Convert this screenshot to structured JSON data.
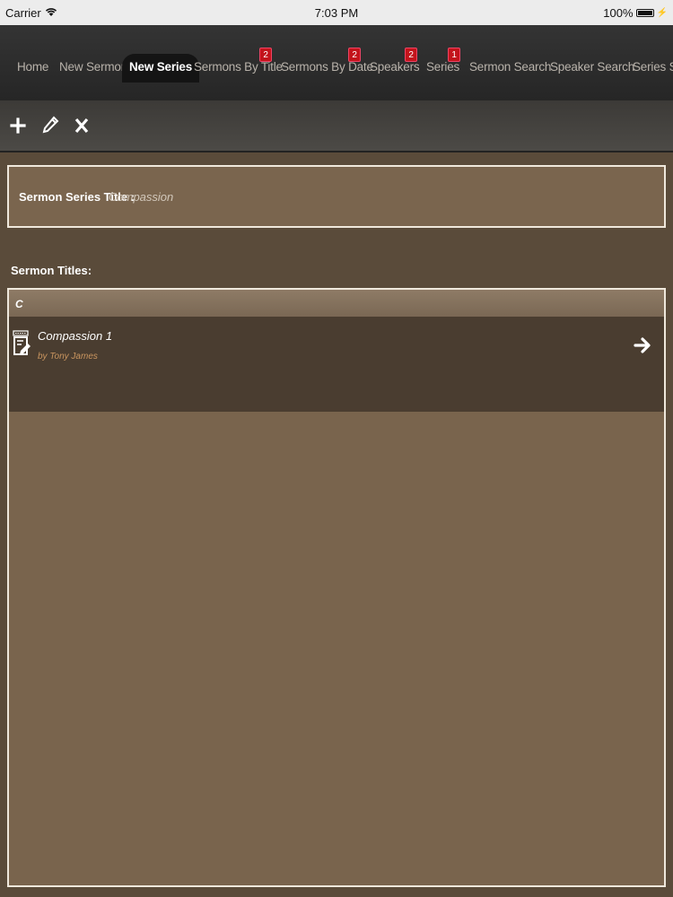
{
  "status_bar": {
    "carrier": "Carrier",
    "time": "7:03 PM",
    "battery": "100%"
  },
  "tabs": [
    {
      "label": "Home",
      "badge": null,
      "active": false
    },
    {
      "label": "New Sermon",
      "badge": null,
      "active": false
    },
    {
      "label": "New Series",
      "badge": null,
      "active": true
    },
    {
      "label": "Sermons By Title",
      "badge": "2",
      "active": false
    },
    {
      "label": "Sermons By Date",
      "badge": "2",
      "active": false
    },
    {
      "label": "Speakers",
      "badge": "2",
      "active": false
    },
    {
      "label": "Series",
      "badge": "1",
      "active": false
    },
    {
      "label": "Sermon Search",
      "badge": null,
      "active": false
    },
    {
      "label": "Speaker Search",
      "badge": null,
      "active": false
    },
    {
      "label": "Series S",
      "badge": null,
      "active": false
    }
  ],
  "toolbar": {
    "add_icon": "plus-icon",
    "edit_icon": "pencil-icon",
    "delete_icon": "x-icon"
  },
  "series": {
    "title_label": "Sermon Series Title :",
    "title_value": "Compassion"
  },
  "sermon_titles": {
    "label": "Sermon Titles:",
    "section_header": "C",
    "items": [
      {
        "title": "Compassion 1",
        "speaker": "by Tony James"
      }
    ]
  },
  "colors": {
    "panel_brown": "#7a654e",
    "row_dark": "#4a3d30",
    "badge_red": "#c3141b",
    "speaker_orange": "#c9955f"
  }
}
